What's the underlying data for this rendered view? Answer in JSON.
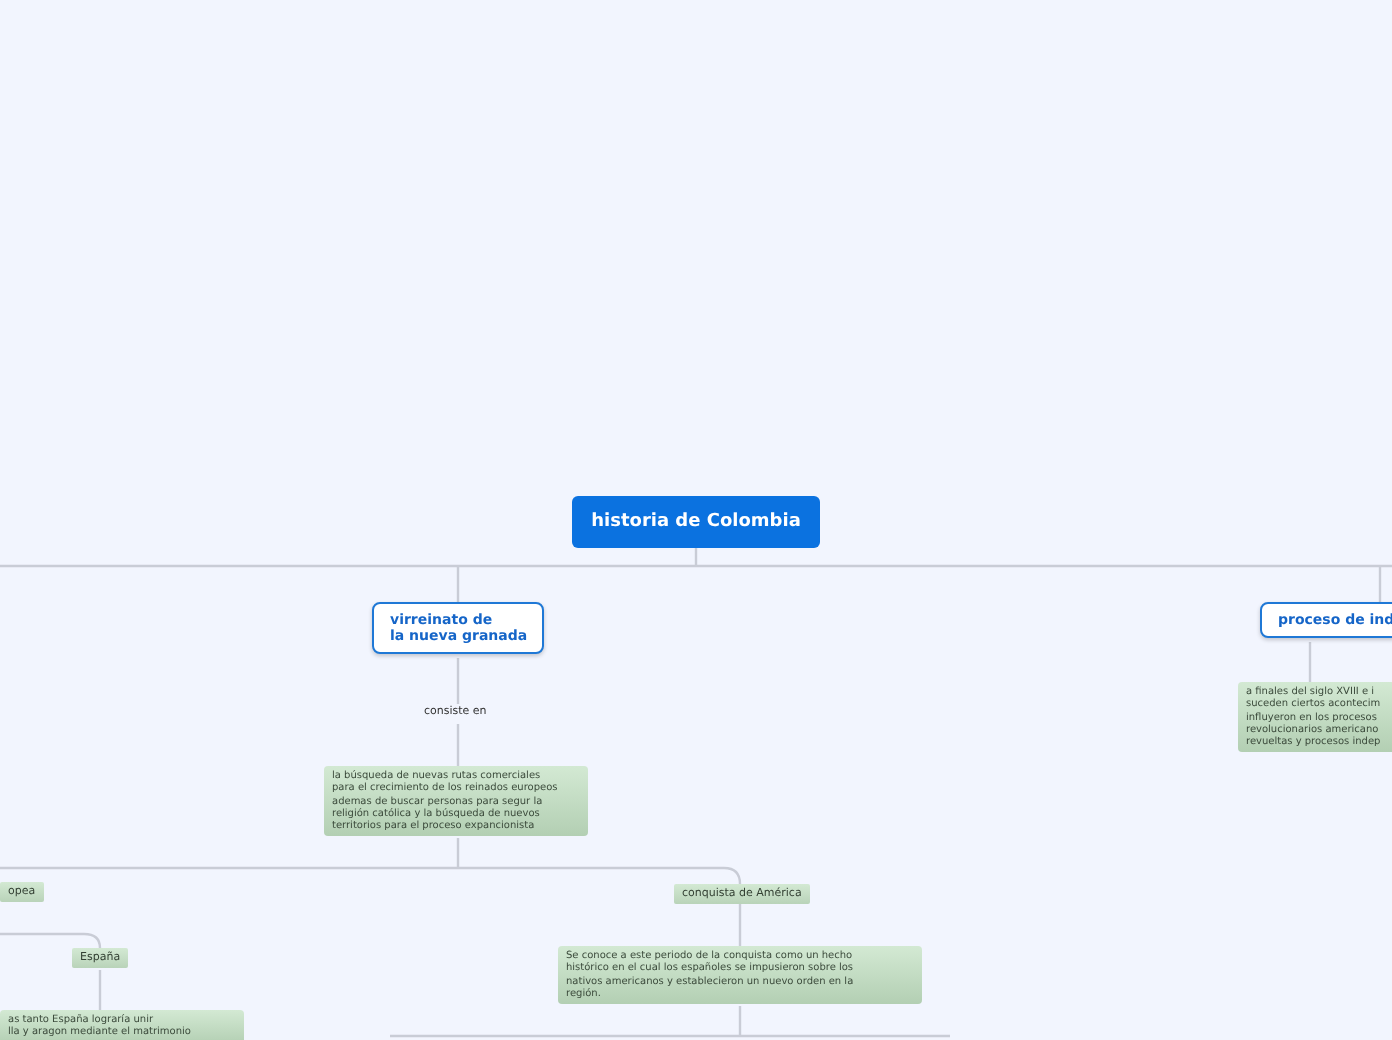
{
  "root": {
    "label": "historia de Colombia"
  },
  "topics": [
    {
      "label": "virreinato de\nla nueva granada"
    },
    {
      "label": "proceso de ind"
    }
  ],
  "link_label": "consiste en",
  "notes": [
    {
      "kind": "note",
      "text": "la búsqueda de nuevas rutas comerciales\npara el crecimiento de los reinados europeos\nademas de buscar personas para segur la\nreligión católica y la búsqueda de nuevos\nterritorios para el proceso expancionista"
    },
    {
      "kind": "note",
      "text": "a finales del siglo XVIII e i\nsuceden ciertos acontecim\ninfluyeron en los procesos\nrevolucionarios americano\nrevueltas y procesos indep"
    },
    {
      "kind": "tag",
      "text": "opea"
    },
    {
      "kind": "tag",
      "text": "España"
    },
    {
      "kind": "note",
      "text": "as tanto España lograría unir\nlla y aragon mediante el matrimonio"
    },
    {
      "kind": "tag",
      "text": "conquista de América"
    },
    {
      "kind": "note",
      "text": "Se conoce a este periodo de la conquista como un hecho\nhistórico en el cual los españoles se impusieron sobre los\nnativos americanos y establecieron un nuevo orden en la\nregión."
    }
  ]
}
